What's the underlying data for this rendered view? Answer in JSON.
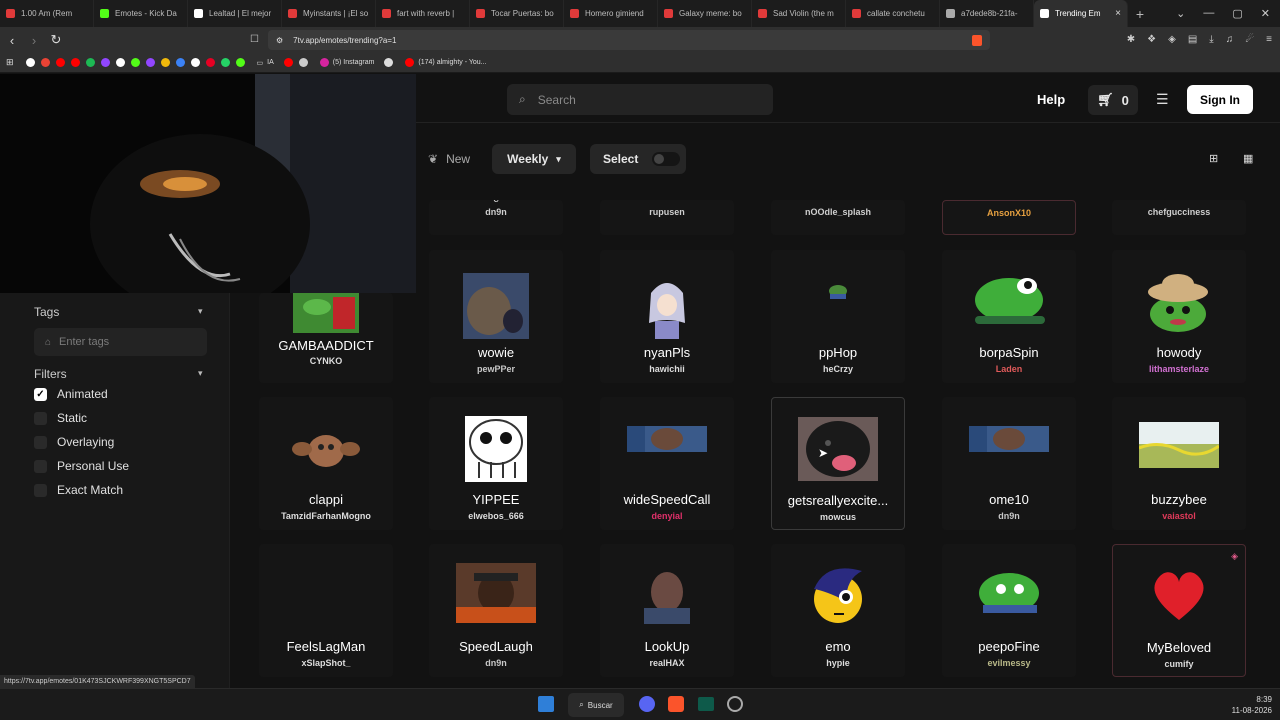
{
  "tabs": [
    {
      "label": "1.00 Am (Rem",
      "color": "#e03a3a"
    },
    {
      "label": "Emotes - Kick Da",
      "color": "#53fc18"
    },
    {
      "label": "Lealtad | El mejor",
      "color": "#ffffff"
    },
    {
      "label": "Myinstants | ¡El so",
      "color": "#e03a3a"
    },
    {
      "label": "fart with reverb |",
      "color": "#e03a3a"
    },
    {
      "label": "Tocar Puertas: bo",
      "color": "#e03a3a"
    },
    {
      "label": "Homero gimiend",
      "color": "#e03a3a"
    },
    {
      "label": "Galaxy meme: bo",
      "color": "#e03a3a"
    },
    {
      "label": "Sad Violin (the m",
      "color": "#e03a3a"
    },
    {
      "label": "callate conchetu",
      "color": "#e03a3a"
    },
    {
      "label": "a7dede8b-21fa-",
      "color": "#aaaaaa"
    },
    {
      "label": "Trending Em",
      "color": "#ffffff"
    }
  ],
  "address": {
    "url": "7tv.app/emotes/trending?a=1"
  },
  "bookmarks": [
    {
      "label": "IA",
      "color": "#cccccc"
    },
    {
      "label": "(5) Instagram",
      "color": "#d6249f"
    },
    {
      "label": "(174) almighty - You...",
      "color": "#ff0000"
    }
  ],
  "header": {
    "search_placeholder": "Search",
    "help": "Help",
    "cart_count": "0",
    "signin": "Sign In"
  },
  "toolbar": {
    "new": "New",
    "weekly": "Weekly",
    "select": "Select"
  },
  "sidebar": {
    "tags_title": "Tags",
    "tags_placeholder": "Enter tags",
    "filters_title": "Filters",
    "filters": [
      {
        "label": "Animated",
        "checked": true
      },
      {
        "label": "Static",
        "checked": false
      },
      {
        "label": "Overlaying",
        "checked": false
      },
      {
        "label": "Personal Use",
        "checked": false
      },
      {
        "label": "Exact Match",
        "checked": false
      }
    ]
  },
  "emotes_top": [
    {
      "name": "c",
      "author": "dn9n",
      "color": "#cfcfcf"
    },
    {
      "name": "",
      "author": "rupusen",
      "color": "#cfcfcf"
    },
    {
      "name": "",
      "author": "nOOdle_splash",
      "color": "#cfcfcf"
    },
    {
      "name": "",
      "author": "AnsonX10",
      "color": "#e6a040"
    },
    {
      "name": "",
      "author": "chefgucciness",
      "color": "#cfcfcf"
    }
  ],
  "emotes": [
    {
      "name": "GAMBAADDICT",
      "author": "CYNKO",
      "author_color": "#dddddd",
      "thumb": "#3f8a32",
      "icon": "gamba"
    },
    {
      "name": "wowie",
      "author": "pewPPer",
      "author_color": "#c8c8c8",
      "thumb": "#6a5a4a",
      "icon": "wowie"
    },
    {
      "name": "nyanPls",
      "author": "hawichii",
      "author_color": "#dddddd",
      "thumb": "#c8c8e0",
      "icon": "nyan"
    },
    {
      "name": "ppHop",
      "author": "heCrzy",
      "author_color": "#dddddd",
      "thumb": "#4a8a3a",
      "icon": "pphop"
    },
    {
      "name": "borpaSpin",
      "author": "Laden",
      "author_color": "#e05a5a",
      "thumb": "#3fae3a",
      "icon": "borpa"
    },
    {
      "name": "howody",
      "author": "lithamsterlaze",
      "author_color": "#d070d0",
      "thumb": "#4caa3a",
      "icon": "howody"
    },
    {
      "name": "clappi",
      "author": "TamzidFarhanMogno",
      "author_color": "#dddddd",
      "thumb": "#a06a4a",
      "icon": "clappi"
    },
    {
      "name": "YIPPEE",
      "author": "elwebos_666",
      "author_color": "#dddddd",
      "thumb": "#ffffff",
      "icon": "yippee"
    },
    {
      "name": "wideSpeedCall",
      "author": "denyial",
      "author_color": "#e0306a",
      "thumb": "#3a5a8a",
      "icon": "wide"
    },
    {
      "name": "getsreallyexcite...",
      "author": "mowcus",
      "author_color": "#dddddd",
      "thumb": "#1a1a1a",
      "icon": "dog"
    },
    {
      "name": "ome10",
      "author": "dn9n",
      "author_color": "#c8c8c8",
      "thumb": "#3a5a8a",
      "icon": "wide"
    },
    {
      "name": "buzzybee",
      "author": "vaiastol",
      "author_color": "#e03a5a",
      "thumb": "#a8b858",
      "icon": "field"
    },
    {
      "name": "FeelsLagMan",
      "author": "xSlapShot_",
      "author_color": "#dddddd",
      "thumb": "#151515",
      "icon": "none"
    },
    {
      "name": "SpeedLaugh",
      "author": "dn9n",
      "author_color": "#c8c8c8",
      "thumb": "#5a3a2a",
      "icon": "photo"
    },
    {
      "name": "LookUp",
      "author": "realHAX",
      "author_color": "#dddddd",
      "thumb": "#3a4a6a",
      "icon": "face"
    },
    {
      "name": "emo",
      "author": "hypie",
      "author_color": "#dddddd",
      "thumb": "#f5c518",
      "icon": "emo"
    },
    {
      "name": "peepoFine",
      "author": "evilmessy",
      "author_color": "#b8b888",
      "thumb": "#3fae3a",
      "icon": "pepe"
    },
    {
      "name": "MyBeloved",
      "author": "cumify",
      "author_color": "#dddddd",
      "thumb": "#e0202a",
      "icon": "heart"
    }
  ],
  "status_url": "https://7tv.app/emotes/01K473SJCKWRF399XNGT5SPCD7",
  "taskbar": {
    "search": "Buscar",
    "time": "8:39",
    "date": "11-08-2026"
  }
}
